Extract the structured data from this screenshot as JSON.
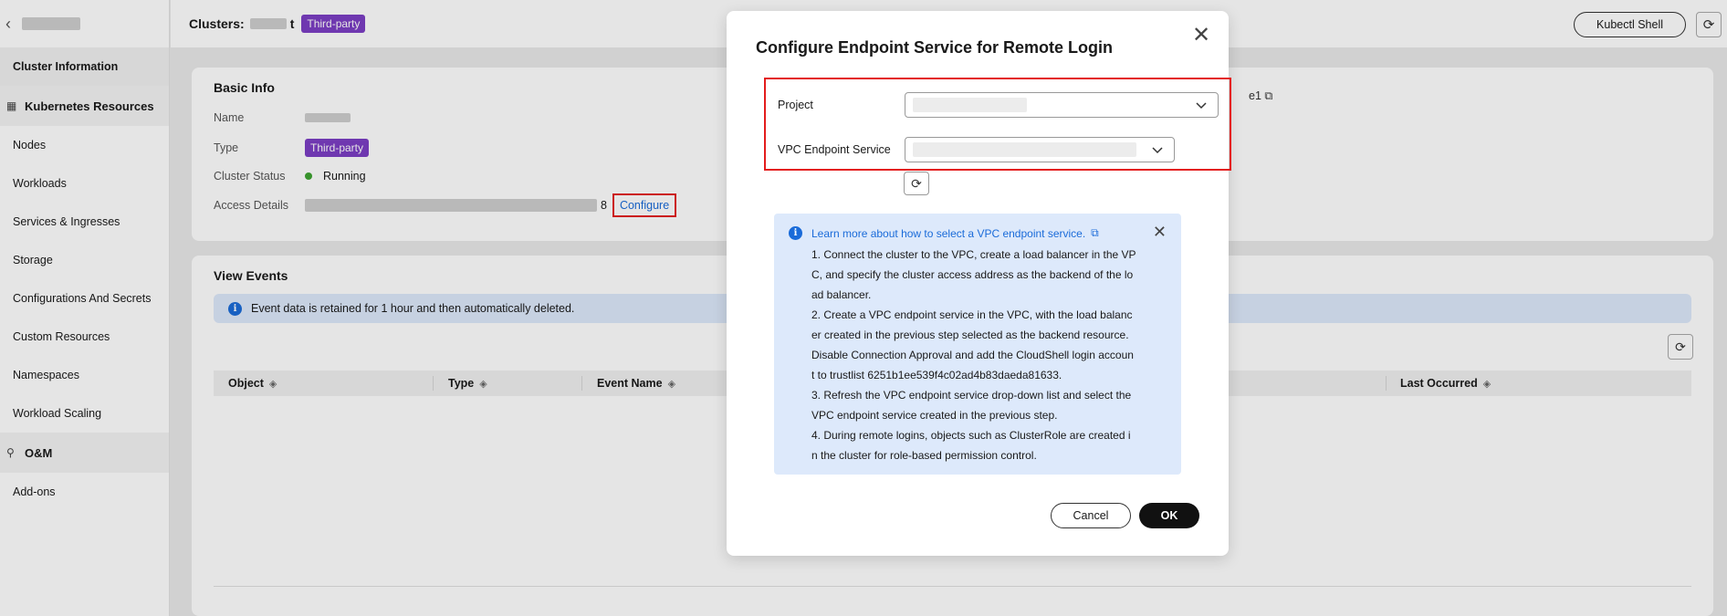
{
  "sidebar": {
    "back_icon": "chevron-left-icon",
    "items": [
      {
        "label": "Cluster Information",
        "type": "item",
        "active": true
      },
      {
        "label": "Kubernetes Resources",
        "type": "group",
        "icon": "grid-icon"
      },
      {
        "label": "Nodes",
        "type": "item"
      },
      {
        "label": "Workloads",
        "type": "item"
      },
      {
        "label": "Services & Ingresses",
        "type": "item"
      },
      {
        "label": "Storage",
        "type": "item"
      },
      {
        "label": "Configurations And Secrets",
        "type": "item"
      },
      {
        "label": "Custom Resources",
        "type": "item"
      },
      {
        "label": "Namespaces",
        "type": "item"
      },
      {
        "label": "Workload Scaling",
        "type": "item"
      },
      {
        "label": "O&M",
        "type": "group",
        "icon": "wrench-icon"
      },
      {
        "label": "Add-ons",
        "type": "item"
      }
    ]
  },
  "header": {
    "title": "Clusters:",
    "cluster_name_suffix": "t",
    "badge": "Third-party",
    "kubectl_button": "Kubectl Shell",
    "refresh_icon": "refresh-icon"
  },
  "basic_info": {
    "title": "Basic Info",
    "name_label": "Name",
    "type_label": "Type",
    "type_value": "Third-party",
    "status_label": "Cluster Status",
    "status_value": "Running",
    "access_label": "Access Details",
    "access_suffix": "8",
    "configure_link": "Configure",
    "right_partial": "e1"
  },
  "events": {
    "title": "View Events",
    "notice": "Event data is retained for 1 hour and then automatically deleted.",
    "columns": [
      "Object",
      "Type",
      "Event Name",
      "Last Occurred"
    ]
  },
  "dialog": {
    "title": "Configure Endpoint Service for Remote Login",
    "project_label": "Project",
    "vpc_label": "VPC Endpoint Service",
    "tips_link": "Learn more about how to select a VPC endpoint service.",
    "tips_text": "1. Connect the cluster to the VPC, create a load balancer in the VP\nC, and specify the cluster access address as the backend of the lo\nad balancer.\n2. Create a VPC endpoint service in the VPC, with the load balanc\ner created in the previous step selected as the backend resource.\nDisable Connection Approval and add the CloudShell login accoun\nt to trustlist 6251b1ee539f4c02ad4b83daeda81633.\n3. Refresh the VPC endpoint service drop-down list and select the\nVPC endpoint service created in the previous step.\n4. During remote logins, objects such as ClusterRole are created i\nn the cluster for role-based permission control.",
    "cancel": "Cancel",
    "ok": "OK"
  },
  "colors": {
    "badge": "#7c3fc4",
    "link": "#1a6bd9",
    "highlight": "#e31c1c",
    "info_bg": "#dde9fb",
    "running": "#3ea331"
  }
}
